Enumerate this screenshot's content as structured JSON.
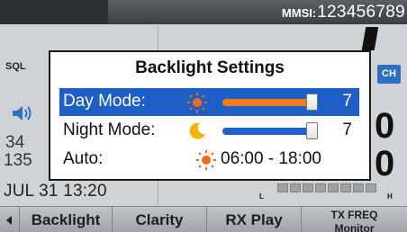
{
  "status_bar": {
    "mmsi_label": "MMSI:",
    "mmsi_value": "123456789"
  },
  "background": {
    "sql_label": "SQL",
    "channel_badge": "CH",
    "freq_1": "34",
    "freq_2": "135",
    "date_time": "JUL 31 13:20",
    "big_digit_1": "0",
    "big_digit_2": "0",
    "meter_low": "L",
    "meter_high": "H"
  },
  "dialog": {
    "title": "Backlight Settings",
    "rows": [
      {
        "label": "Day Mode:",
        "icon": "sun-icon",
        "level": 7,
        "max": 7,
        "selected": true
      },
      {
        "label": "Night Mode:",
        "icon": "moon-icon",
        "level": 7,
        "max": 7,
        "selected": false
      },
      {
        "label": "Auto:",
        "icon": "sun-icon",
        "time_range": "06:00 - 18:00"
      }
    ]
  },
  "softkeys": {
    "items": [
      {
        "label": "Backlight"
      },
      {
        "label": "Clarity"
      },
      {
        "label": "RX Play"
      },
      {
        "label_line1": "TX FREQ",
        "label_line2": "Monitor"
      }
    ]
  },
  "colors": {
    "selection_bg": "#1e5fc7",
    "day_slider": "#f47a1c",
    "night_slider": "#1f5fc9",
    "sun": "#f26b16",
    "moon": "#f1b400"
  }
}
